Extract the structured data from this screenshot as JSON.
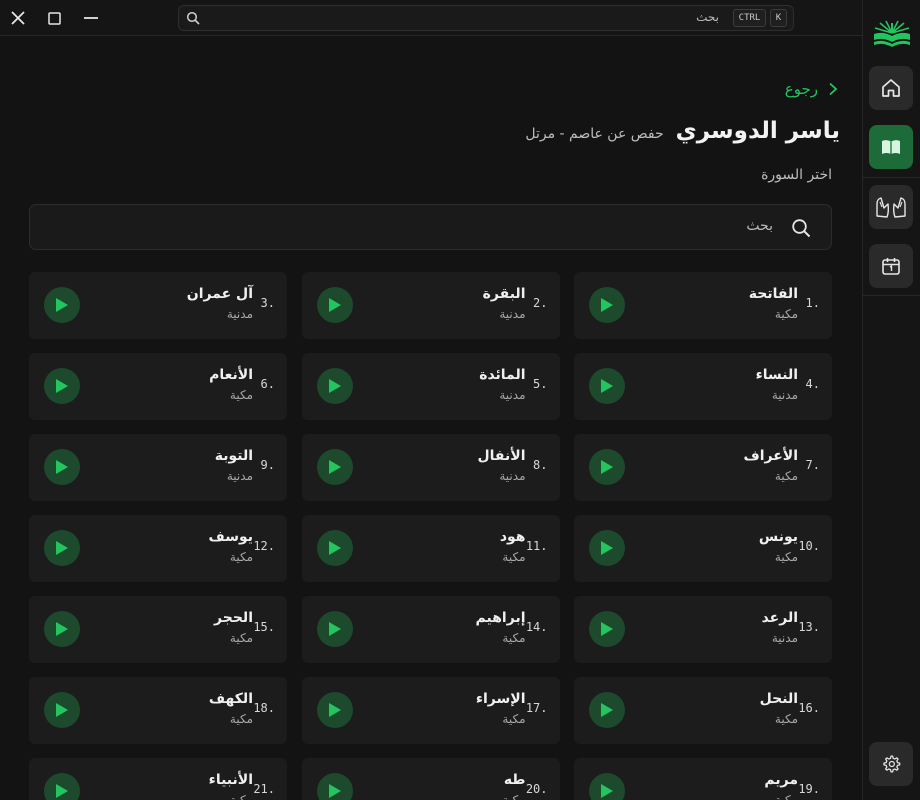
{
  "titlebar": {
    "search_placeholder": "بحث",
    "shortcut_ctrl": "CTRL",
    "shortcut_key": "K"
  },
  "sidebar": {
    "items": [
      {
        "icon": "home-icon",
        "active": false
      },
      {
        "icon": "book-icon",
        "active": true
      },
      {
        "icon": "praying-hands-icon",
        "active": false
      },
      {
        "icon": "calendar-icon",
        "active": false
      }
    ],
    "settings_icon": "gear-icon"
  },
  "header": {
    "back_label": "رجوع",
    "reciter_name": "ياسر الدوسري",
    "recitation": "حفص عن عاصم - مرتل",
    "choose_label": "اختر السورة"
  },
  "search": {
    "placeholder": "بحث"
  },
  "colors": {
    "accent": "#22c55e",
    "active_bg": "#1d6b39",
    "play_bg": "#1d4a2c"
  },
  "surahs": [
    {
      "num": "1.",
      "name": "الفاتحة",
      "type": "مكية"
    },
    {
      "num": "2.",
      "name": "البقرة",
      "type": "مدنية"
    },
    {
      "num": "3.",
      "name": "آل عمران",
      "type": "مدنية"
    },
    {
      "num": "4.",
      "name": "النساء",
      "type": "مدنية"
    },
    {
      "num": "5.",
      "name": "المائدة",
      "type": "مدنية"
    },
    {
      "num": "6.",
      "name": "الأنعام",
      "type": "مكية"
    },
    {
      "num": "7.",
      "name": "الأعراف",
      "type": "مكية"
    },
    {
      "num": "8.",
      "name": "الأنفال",
      "type": "مدنية"
    },
    {
      "num": "9.",
      "name": "التوبة",
      "type": "مدنية"
    },
    {
      "num": "10.",
      "name": "يونس",
      "type": "مكية"
    },
    {
      "num": "11.",
      "name": "هود",
      "type": "مكية"
    },
    {
      "num": "12.",
      "name": "يوسف",
      "type": "مكية"
    },
    {
      "num": "13.",
      "name": "الرعد",
      "type": "مدنية"
    },
    {
      "num": "14.",
      "name": "إبراهيم",
      "type": "مكية"
    },
    {
      "num": "15.",
      "name": "الحجر",
      "type": "مكية"
    },
    {
      "num": "16.",
      "name": "النحل",
      "type": "مكية"
    },
    {
      "num": "17.",
      "name": "الإسراء",
      "type": "مكية"
    },
    {
      "num": "18.",
      "name": "الكهف",
      "type": "مكية"
    },
    {
      "num": "19.",
      "name": "مريم",
      "type": "مكية"
    },
    {
      "num": "20.",
      "name": "طه",
      "type": "مكية"
    },
    {
      "num": "21.",
      "name": "الأنبياء",
      "type": "مكية"
    }
  ]
}
